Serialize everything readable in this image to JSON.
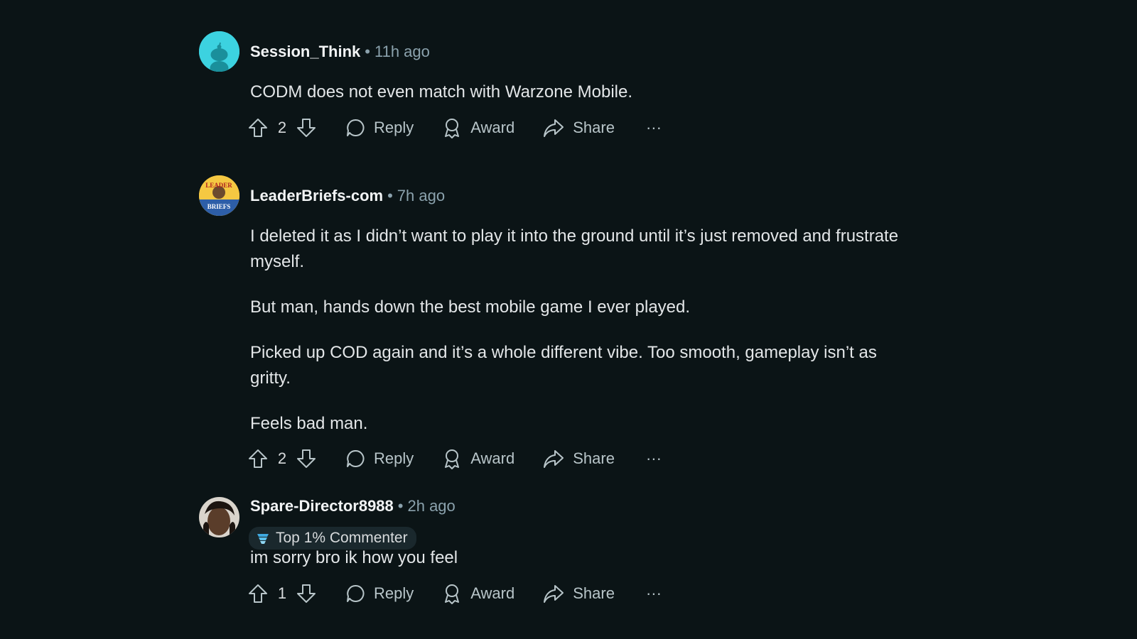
{
  "comments": [
    {
      "username": "Session_Think",
      "separator": "•",
      "time": "11h ago",
      "paragraphs": [
        "CODM does not even match with Warzone Mobile."
      ],
      "score": "2",
      "reply_label": "Reply",
      "award_label": "Award",
      "share_label": "Share",
      "more_label": "···",
      "avatar": "reddit-snoo-avatar"
    },
    {
      "username": "LeaderBriefs-com",
      "separator": "•",
      "time": "7h ago",
      "paragraphs": [
        "I deleted it as I didn’t want to play it into the ground until it’s just removed and frustrate myself.",
        "But man, hands down the best mobile game I ever played.",
        "Picked up COD again and it’s a whole different vibe. Too smooth, gameplay isn’t as gritty.",
        "Feels bad man."
      ],
      "score": "2",
      "reply_label": "Reply",
      "award_label": "Award",
      "share_label": "Share",
      "more_label": "···",
      "avatar": "leaderbriefs-logo-avatar",
      "avatar_text": [
        "LEADER",
        "BRIEFS"
      ]
    },
    {
      "username": "Spare-Director8988",
      "separator": "•",
      "time": "2h ago",
      "badge": "Top 1% Commenter",
      "paragraphs": [
        "im sorry bro ik how you feel"
      ],
      "score": "1",
      "reply_label": "Reply",
      "award_label": "Award",
      "share_label": "Share",
      "more_label": "···",
      "avatar": "photo-avatar"
    }
  ],
  "colors": {
    "background": "#0b1416",
    "text": "#e3e6e8",
    "meta": "#8ba2ad",
    "snoo_avatar": "#3cd2e0"
  }
}
